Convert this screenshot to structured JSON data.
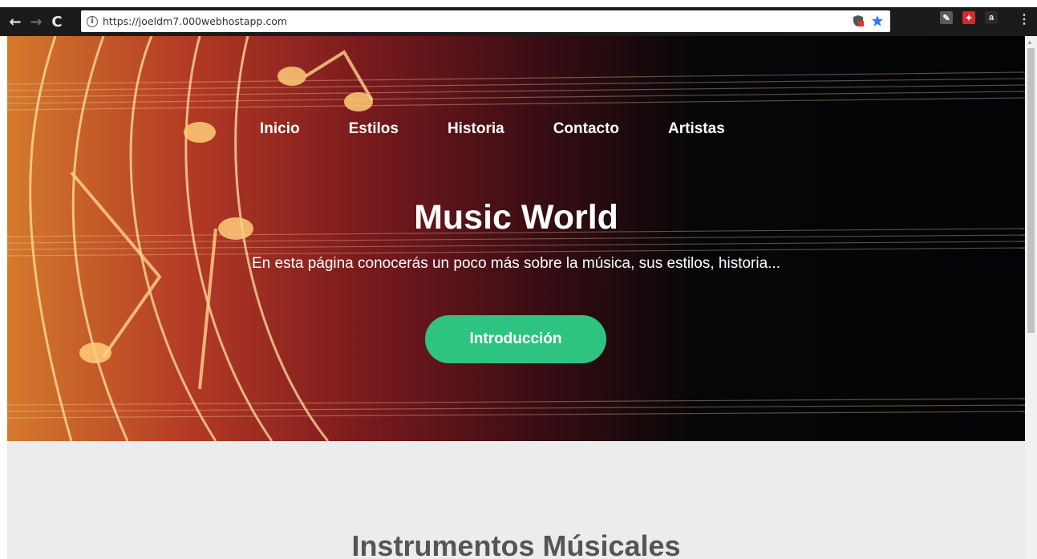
{
  "browser": {
    "url": "https://joeldm7.000webhostapp.com",
    "back_icon": "arrow-left-icon",
    "forward_icon": "arrow-right-icon",
    "reload_icon": "reload-icon"
  },
  "site": {
    "nav": [
      "Inicio",
      "Estilos",
      "Historia",
      "Contacto",
      "Artistas"
    ],
    "title": "Music World",
    "subtitle": "En esta página conocerás un poco más sobre la música, sus estilos, historia...",
    "cta_label": "Introducción",
    "section_title": "Instrumentos Músicales"
  },
  "colors": {
    "cta": "#2fc381",
    "section_bg": "#ececec",
    "hero_dark": "#050608",
    "hero_warm": "#d47a2c"
  }
}
